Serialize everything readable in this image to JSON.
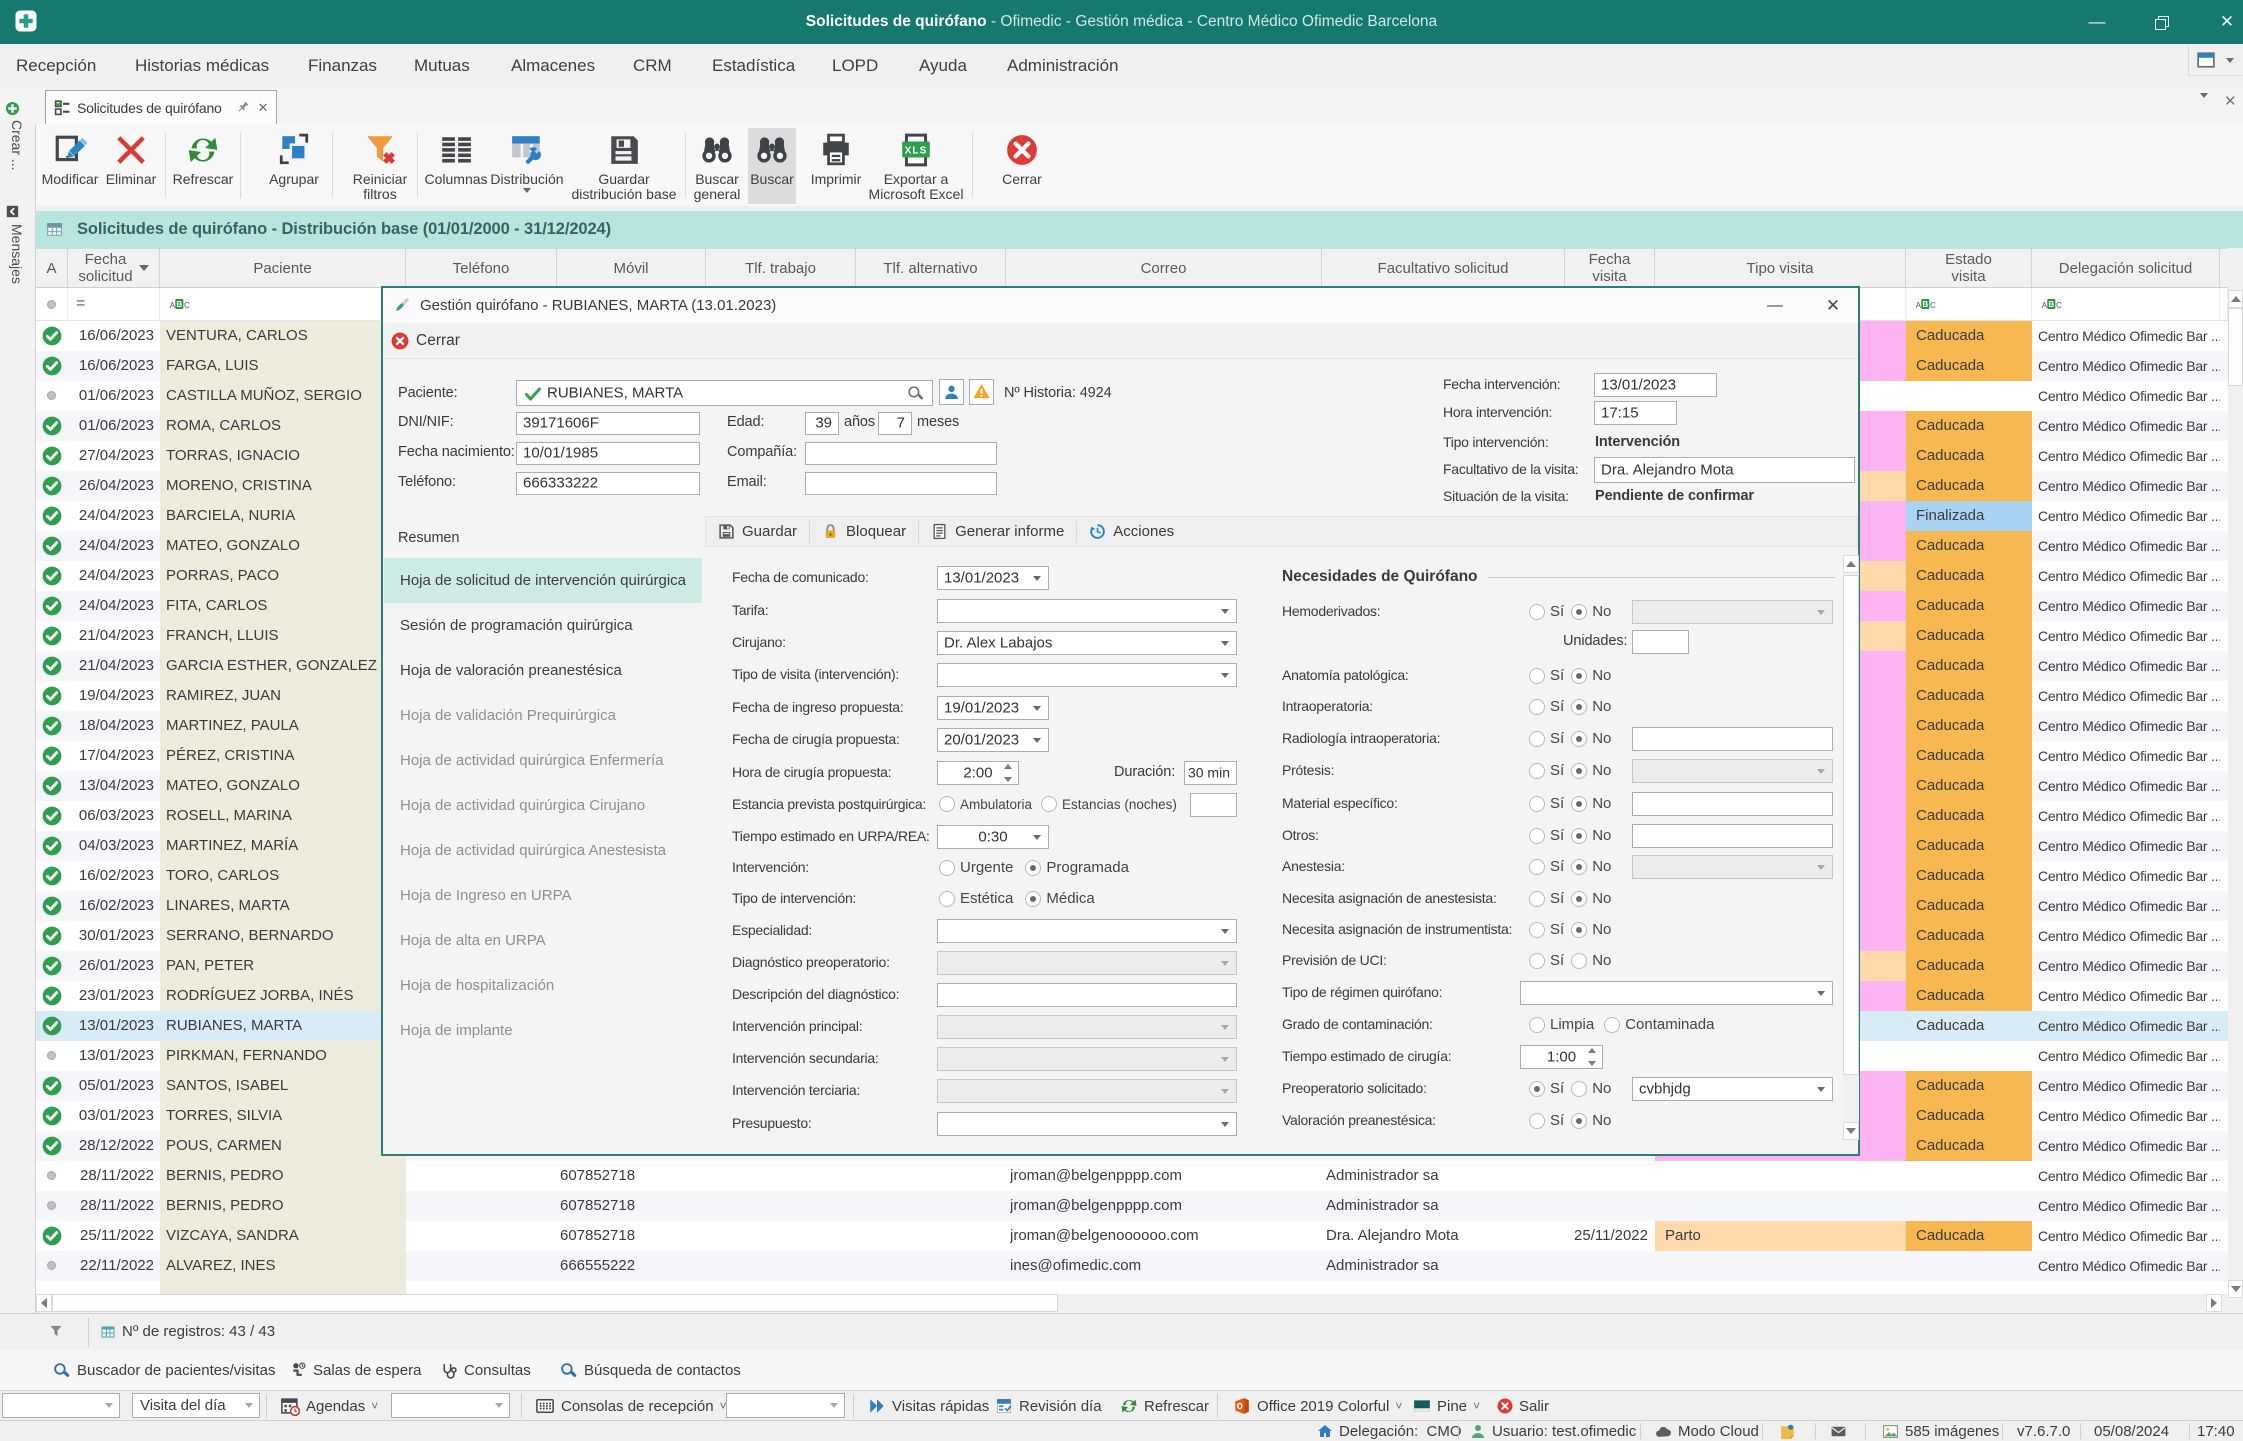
{
  "window": {
    "title_primary": "Solicitudes de quirófano",
    "title_rest": " - Ofimedic - Gestión médica - Centro Médico Ofimedic Barcelona",
    "controls": [
      "minimize",
      "maximize",
      "close"
    ]
  },
  "menu": {
    "items": [
      "Recepción",
      "Historias médicas",
      "Finanzas",
      "Mutuas",
      "Almacenes",
      "CRM",
      "Estadística",
      "LOPD",
      "Ayuda",
      "Administración"
    ]
  },
  "tab": {
    "label": "Solicitudes de quirófano"
  },
  "sidebar": {
    "crear": "Crear ...",
    "mensajes": "Mensajes"
  },
  "toolbar": {
    "buttons": [
      {
        "icon": "modificar",
        "label": "Modificar"
      },
      {
        "icon": "eliminar",
        "label": "Eliminar"
      },
      {
        "icon": "refrescar",
        "label": "Refrescar"
      },
      {
        "icon": "agrupar",
        "label": "Agrupar"
      },
      {
        "icon": "filtro",
        "label": "Reiniciar\nfiltros"
      },
      {
        "icon": "columnas",
        "label": "Columnas"
      },
      {
        "icon": "distribucion",
        "label": "Distribución",
        "arrow": true
      },
      {
        "icon": "guardar",
        "label": "Guardar\ndistribución base"
      },
      {
        "icon": "binoculares",
        "label": "Buscar\ngeneral"
      },
      {
        "icon": "binoculares",
        "label": "Buscar",
        "selected": true
      },
      {
        "icon": "imprimir",
        "label": "Imprimir"
      },
      {
        "icon": "xls",
        "label": "Exportar a\nMicrosoft Excel"
      },
      {
        "icon": "cerrar",
        "label": "Cerrar"
      }
    ]
  },
  "caption": {
    "text": "Solicitudes de quirófano - Distribución base (01/01/2000 - 31/12/2024)"
  },
  "grid": {
    "columns": [
      "A",
      "Fecha\nsolicitud",
      "Paciente",
      "Teléfono",
      "Móvil",
      "Tlf. trabajo",
      "Tlf. alternativo",
      "Correo",
      "Facultativo solicitud",
      "Fecha\nvisita",
      "Tipo visita",
      "Estado\nvisita",
      "Delegación solicitud"
    ],
    "delegacion_text": "Centro Médico Ofimedic Bar ...",
    "colors": {
      "pink": "#fbb3f2",
      "peach": "#fdd9ac",
      "caducada": "#f7b851",
      "finalizada": "#a9d3f2",
      "selected": "#d8ecf7",
      "beige": "#edebdc",
      "alt": "#f5f6fa"
    },
    "rows": [
      {
        "check": 1,
        "fecha": "16/06/2023",
        "paciente": "VENTURA, CARLOS",
        "tipo": "pink",
        "estado": "Caducada"
      },
      {
        "check": 1,
        "fecha": "16/06/2023",
        "paciente": "FARGA, LUIS",
        "tipo": "pink",
        "estado": "Caducada"
      },
      {
        "check": 0,
        "fecha": "01/06/2023",
        "paciente": "CASTILLA MUÑOZ, SERGIO",
        "tipo": "",
        "estado": ""
      },
      {
        "check": 1,
        "fecha": "01/06/2023",
        "paciente": "ROMA, CARLOS",
        "tipo": "pink",
        "estado": "Caducada"
      },
      {
        "check": 1,
        "fecha": "27/04/2023",
        "paciente": "TORRAS, IGNACIO",
        "tipo": "pink",
        "estado": "Caducada"
      },
      {
        "check": 1,
        "fecha": "26/04/2023",
        "paciente": "MORENO, CRISTINA",
        "tipo": "peach",
        "estado": "Caducada"
      },
      {
        "check": 1,
        "fecha": "24/04/2023",
        "paciente": "BARCIELA, NURIA",
        "tipo": "pink",
        "estado": "Finalizada"
      },
      {
        "check": 1,
        "fecha": "24/04/2023",
        "paciente": "MATEO, GONZALO",
        "tipo": "pink",
        "estado": "Caducada"
      },
      {
        "check": 1,
        "fecha": "24/04/2023",
        "paciente": "PORRAS, PACO",
        "tipo": "peach",
        "estado": "Caducada"
      },
      {
        "check": 1,
        "fecha": "24/04/2023",
        "paciente": "FITA, CARLOS",
        "tipo": "pink",
        "estado": "Caducada"
      },
      {
        "check": 1,
        "fecha": "21/04/2023",
        "paciente": "FRANCH, LLUIS",
        "tipo": "peach",
        "estado": "Caducada"
      },
      {
        "check": 1,
        "fecha": "21/04/2023",
        "paciente": "GARCIA ESTHER, GONZALEZ",
        "tipo": "pink",
        "estado": "Caducada"
      },
      {
        "check": 1,
        "fecha": "19/04/2023",
        "paciente": "RAMIREZ, JUAN",
        "tipo": "pink",
        "estado": "Caducada"
      },
      {
        "check": 1,
        "fecha": "18/04/2023",
        "paciente": "MARTINEZ, PAULA",
        "tipo": "pink",
        "estado": "Caducada"
      },
      {
        "check": 1,
        "fecha": "17/04/2023",
        "paciente": "PÉREZ, CRISTINA",
        "tipo": "pink",
        "estado": "Caducada"
      },
      {
        "check": 1,
        "fecha": "13/04/2023",
        "paciente": "MATEO, GONZALO",
        "tipo": "pink",
        "estado": "Caducada"
      },
      {
        "check": 1,
        "fecha": "06/03/2023",
        "paciente": "ROSELL, MARINA",
        "tipo": "pink",
        "estado": "Caducada"
      },
      {
        "check": 1,
        "fecha": "04/03/2023",
        "paciente": "MARTINEZ, MARÍA",
        "tipo": "pink",
        "estado": "Caducada"
      },
      {
        "check": 1,
        "fecha": "16/02/2023",
        "paciente": "TORO, CARLOS",
        "tipo": "pink",
        "estado": "Caducada"
      },
      {
        "check": 1,
        "fecha": "16/02/2023",
        "paciente": "LINARES, MARTA",
        "tipo": "pink",
        "estado": "Caducada"
      },
      {
        "check": 1,
        "fecha": "30/01/2023",
        "paciente": "SERRANO, BERNARDO",
        "tipo": "pink",
        "estado": "Caducada"
      },
      {
        "check": 1,
        "fecha": "26/01/2023",
        "paciente": "PAN, PETER",
        "tipo": "peach",
        "estado": "Caducada"
      },
      {
        "check": 1,
        "fecha": "23/01/2023",
        "paciente": "RODRÍGUEZ JORBA, INÉS",
        "tipo": "pink",
        "estado": "Caducada"
      },
      {
        "check": 1,
        "fecha": "13/01/2023",
        "paciente": "RUBIANES, MARTA",
        "tipo": "pink",
        "estado": "Caducada",
        "selected": true
      },
      {
        "check": 0,
        "fecha": "13/01/2023",
        "paciente": "PIRKMAN, FERNANDO",
        "tipo": "",
        "estado": ""
      },
      {
        "check": 1,
        "fecha": "05/01/2023",
        "paciente": "SANTOS, ISABEL",
        "tipo": "pink",
        "estado": "Caducada"
      },
      {
        "check": 1,
        "fecha": "03/01/2023",
        "paciente": "TORRES, SILVIA",
        "tipo": "pink",
        "estado": "Caducada"
      },
      {
        "check": 1,
        "fecha": "28/12/2022",
        "paciente": "POUS, CARMEN",
        "tipo": "pink",
        "estado": "Caducada"
      },
      {
        "check": 0,
        "fecha": "28/11/2022",
        "paciente": "BERNIS, PEDRO",
        "movil": "607852718",
        "correo": "jroman@belgenpppp.com",
        "facultativo": "Administrador sa",
        "tipo": "",
        "estado": ""
      },
      {
        "check": 0,
        "fecha": "28/11/2022",
        "paciente": "BERNIS, PEDRO",
        "movil": "607852718",
        "correo": "jroman@belgenpppp.com",
        "facultativo": "Administrador sa",
        "tipo": "",
        "estado": ""
      },
      {
        "check": 1,
        "fecha": "25/11/2022",
        "paciente": "VIZCAYA, SANDRA",
        "movil": "607852718",
        "correo": "jroman@belgenoooooo.com",
        "facultativo": "Dra. Alejandro Mota",
        "fecha_visita": "25/11/2022",
        "tipo": "peach",
        "tipo_text": "Parto",
        "estado": "Caducada"
      },
      {
        "check": 0,
        "fecha": "22/11/2022",
        "paciente": "ALVAREZ, INES",
        "movil": "666555222",
        "correo": "ines@ofimedic.com",
        "facultativo": "Administrador sa",
        "tipo": "",
        "estado": ""
      }
    ]
  },
  "dialog": {
    "title": "Gestión quirófano - RUBIANES, MARTA (13.01.2023)",
    "cerrar": "Cerrar",
    "patient": {
      "paciente_label": "Paciente:",
      "paciente_value": "RUBIANES, MARTA",
      "historia_label": "Nº Historia:",
      "historia_value": "4924",
      "dni_label": "DNI/NIF:",
      "dni_value": "39171606F",
      "edad_label": "Edad:",
      "edad_anos": "39",
      "anos_label": "años",
      "edad_meses": "7",
      "meses_label": "meses",
      "nacimiento_label": "Fecha nacimiento:",
      "nacimiento_value": "10/01/1985",
      "compania_label": "Compañía:",
      "compania_value": "",
      "telefono_label": "Teléfono:",
      "telefono_value": "666333222",
      "email_label": "Email:",
      "email_value": ""
    },
    "visit": {
      "fecha_label": "Fecha intervención:",
      "fecha_value": "13/01/2023",
      "hora_label": "Hora intervención:",
      "hora_value": "17:15",
      "tipo_label": "Tipo intervención:",
      "tipo_value": "Intervención",
      "facultativo_label": "Facultativo de la visita:",
      "facultativo_value": "Dra. Alejandro Mota",
      "situacion_label": "Situación de la visita:",
      "situacion_value": "Pendiente de confirmar"
    },
    "resumen_label": "Resumen",
    "toolbar": [
      {
        "icon": "guardar-sm",
        "label": "Guardar"
      },
      {
        "icon": "candado",
        "label": "Bloquear"
      },
      {
        "icon": "informe",
        "label": "Generar informe"
      },
      {
        "icon": "acciones",
        "label": "Acciones"
      }
    ],
    "nav": [
      {
        "label": "Hoja de solicitud de intervención quirúrgica",
        "active": true
      },
      {
        "label": "Sesión de programación quirúrgica"
      },
      {
        "label": "Hoja de valoración preanestésica"
      },
      {
        "label": "Hoja de validación Prequirúrgica",
        "muted": true
      },
      {
        "label": "Hoja de actividad quirúrgica Enfermería",
        "muted": true
      },
      {
        "label": "Hoja de actividad quirúrgica Cirujano",
        "muted": true
      },
      {
        "label": "Hoja de actividad quirúrgica Anestesista",
        "muted": true
      },
      {
        "label": "Hoja de Ingreso en URPA",
        "muted": true
      },
      {
        "label": "Hoja de alta en URPA",
        "muted": true
      },
      {
        "label": "Hoja de hospitalización",
        "muted": true
      },
      {
        "label": "Hoja de implante",
        "muted": true
      }
    ],
    "form": [
      {
        "label": "Fecha de comunicado:",
        "type": "datecombo",
        "value": "13/01/2023"
      },
      {
        "label": "Tarifa:",
        "type": "dd",
        "value": ""
      },
      {
        "label": "Cirujano:",
        "type": "dd",
        "value": "Dr. Alex Labajos"
      },
      {
        "label": "Tipo de visita (intervención):",
        "type": "dd",
        "value": ""
      },
      {
        "label": "Fecha de ingreso propuesta:",
        "type": "datecombo",
        "value": "19/01/2023"
      },
      {
        "label": "Fecha de cirugía propuesta:",
        "type": "datecombo",
        "value": "20/01/2023"
      },
      {
        "label": "Hora de cirugía propuesta:",
        "type": "spin_dur",
        "value": "2:00",
        "dur_label": "Duración:",
        "dur_value": "30 min"
      },
      {
        "label": "Estancia prevista postquirúrgica:",
        "type": "estancia",
        "options": [
          "Ambulatoria",
          "Estancias (noches)"
        ]
      },
      {
        "label": "Tiempo estimado en URPA/REA:",
        "type": "timecombo",
        "value": "0:30"
      },
      {
        "label": "Intervención:",
        "type": "radios",
        "options": [
          "Urgente",
          "Programada"
        ],
        "sel": 1
      },
      {
        "label": "Tipo de intervención:",
        "type": "radios",
        "options": [
          "Estética",
          "Médica"
        ],
        "sel": 1
      },
      {
        "label": "Especialidad:",
        "type": "dd",
        "value": ""
      },
      {
        "label": "Diagnóstico preoperatorio:",
        "type": "dd_dis",
        "value": ""
      },
      {
        "label": "Descripción del diagnóstico:",
        "type": "text",
        "value": ""
      },
      {
        "label": "Intervención principal:",
        "type": "dd_dis",
        "value": ""
      },
      {
        "label": "Intervención secundaria:",
        "type": "dd_dis",
        "value": ""
      },
      {
        "label": "Intervención terciaria:",
        "type": "dd_dis",
        "value": ""
      },
      {
        "label": "Presupuesto:",
        "type": "dd",
        "value": ""
      }
    ],
    "necesidades": {
      "title": "Necesidades de Quirófano",
      "si": "Sí",
      "no": "No",
      "rows": [
        {
          "label": "Hemoderivados:",
          "type": "yesno_dddis",
          "sel": "no"
        },
        {
          "label": "Unidades:",
          "type": "unidades"
        },
        {
          "label": "Anatomía patológica:",
          "type": "yesno",
          "sel": "no"
        },
        {
          "label": "Intraoperatoria:",
          "type": "yesno",
          "sel": "no"
        },
        {
          "label": "Radiología intraoperatoria:",
          "type": "yesno_text",
          "sel": "no"
        },
        {
          "label": "Prótesis:",
          "type": "yesno_dddis",
          "sel": "no"
        },
        {
          "label": "Material específico:",
          "type": "yesno_text",
          "sel": "no"
        },
        {
          "label": "Otros:",
          "type": "yesno_text",
          "sel": "no"
        },
        {
          "label": "Anestesia:",
          "type": "yesno_dddis",
          "sel": "no"
        },
        {
          "label": "Necesita asignación de anestesista:",
          "type": "yesno",
          "sel": "no"
        },
        {
          "label": "Necesita asignación de instrumentista:",
          "type": "yesno",
          "sel": "no"
        },
        {
          "label": "Previsión de UCI:",
          "type": "yesno",
          "sel": ""
        },
        {
          "label": "Tipo de régimen quirófano:",
          "type": "widedd",
          "value": ""
        },
        {
          "label": "Grado de contaminación:",
          "type": "radios2",
          "options": [
            "Limpia",
            "Contaminada"
          ],
          "sel": -1
        },
        {
          "label": "Tiempo estimado de cirugía:",
          "type": "spinner",
          "value": "1:00"
        },
        {
          "label": "Preoperatorio solicitado:",
          "type": "yesno_dd",
          "sel": "si",
          "value": "cvbhjdg"
        },
        {
          "label": "Valoración preanestésica:",
          "type": "yesno",
          "sel": "no"
        }
      ]
    }
  },
  "bottom": {
    "registros": "Nº de registros: 43 / 43",
    "buscador_items": [
      {
        "icon": "lupa",
        "label": "Buscador de pacientes/visitas"
      },
      {
        "icon": "espera",
        "label": "Salas de espera"
      },
      {
        "icon": "consultas",
        "label": "Consultas"
      },
      {
        "icon": "lupa",
        "label": "Búsqueda de contactos"
      }
    ],
    "visita_dia": "Visita del día",
    "agendas": "Agendas",
    "consolas": "Consolas de recepción",
    "visitas_rapidas": "Visitas rápidas",
    "revision_dia": "Revisión día",
    "refrescar": "Refrescar",
    "office": "Office 2019 Colorful",
    "pine": "Pine",
    "salir": "Salir"
  },
  "statusbar": {
    "delegacion_label": "Delegación:",
    "delegacion_value": "CMO",
    "usuario_label": "Usuario:",
    "usuario_value": "test.ofimedic",
    "modo": "Modo Cloud",
    "imagenes": "585 imágenes",
    "version": "v7.6.7.0",
    "fecha": "05/08/2024",
    "hora": "17:40"
  }
}
